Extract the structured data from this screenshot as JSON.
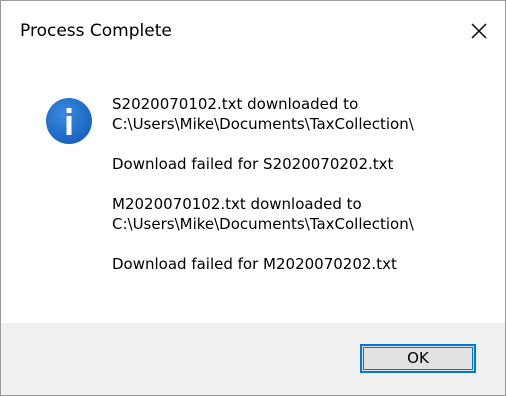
{
  "dialog": {
    "title": "Process Complete",
    "close_glyph": "close-icon",
    "icon": "information-icon",
    "messages": [
      {
        "line1": "S2020070102.txt downloaded to",
        "line2": "C:\\Users\\Mike\\Documents\\TaxCollection\\"
      },
      {
        "line1": "Download failed for S2020070202.txt"
      },
      {
        "line1": "M2020070102.txt downloaded to",
        "line2": "C:\\Users\\Mike\\Documents\\TaxCollection\\"
      },
      {
        "line1": "Download failed for M2020070202.txt"
      }
    ],
    "ok_label": "OK"
  },
  "colors": {
    "info_blue": "#1c6bc6",
    "button_focus_border": "#0078d7",
    "footer_bg": "#f0f0f0",
    "button_bg": "#e1e1e1"
  }
}
